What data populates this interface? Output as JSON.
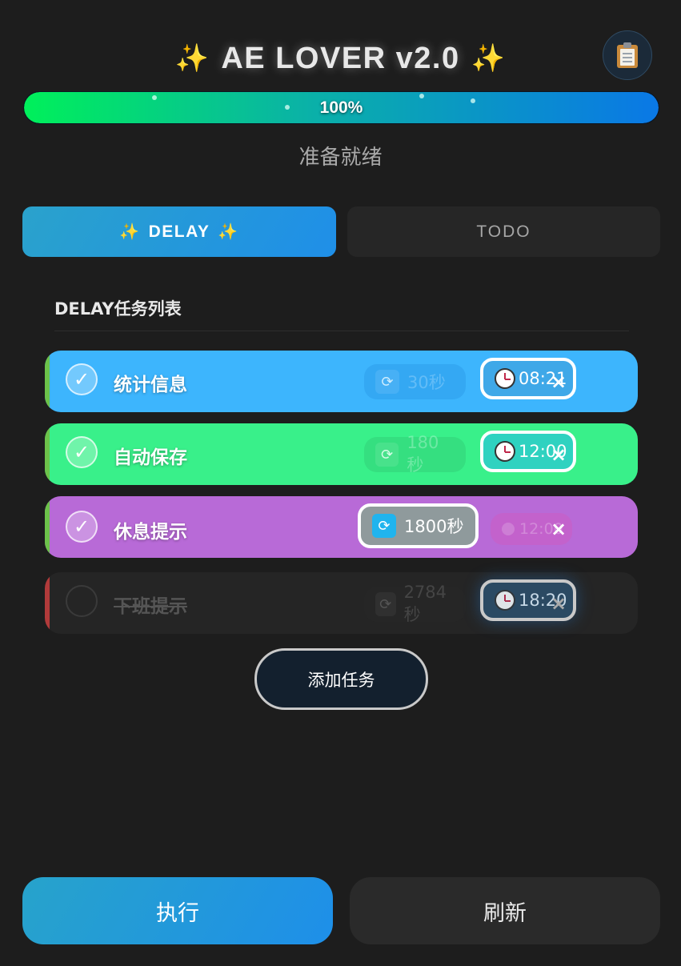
{
  "header": {
    "title": "AE LOVER v2.0",
    "sparkle_left": "✨",
    "sparkle_right": "✨",
    "clipboard_icon": "clipboard-icon"
  },
  "progress": {
    "percent_label": "100%",
    "value": 100
  },
  "status": "准备就绪",
  "tabs": [
    {
      "label": "DELAY",
      "active": true,
      "sparkle": "✨"
    },
    {
      "label": "TODO",
      "active": false
    }
  ],
  "section": {
    "title": "DELAY任务列表"
  },
  "tasks": [
    {
      "name": "统计信息",
      "checked": true,
      "interval": "30秒",
      "time": "08:21",
      "mode": "time",
      "color": "#3ab4ff"
    },
    {
      "name": "自动保存",
      "checked": true,
      "interval": "180秒",
      "time": "12:00",
      "mode": "time",
      "color": "#34ef87"
    },
    {
      "name": "休息提示",
      "checked": true,
      "interval": "1800秒",
      "time": "12:00",
      "mode": "interval",
      "color": "#b76bd6"
    },
    {
      "name": "下班提示",
      "checked": false,
      "interval": "2784秒",
      "time": "18:20",
      "mode": "time",
      "color": "#252525"
    }
  ],
  "delete_symbol": "×",
  "check_symbol": "✓",
  "add_button": "添加任务",
  "footer": {
    "execute": "执行",
    "refresh": "刷新"
  }
}
